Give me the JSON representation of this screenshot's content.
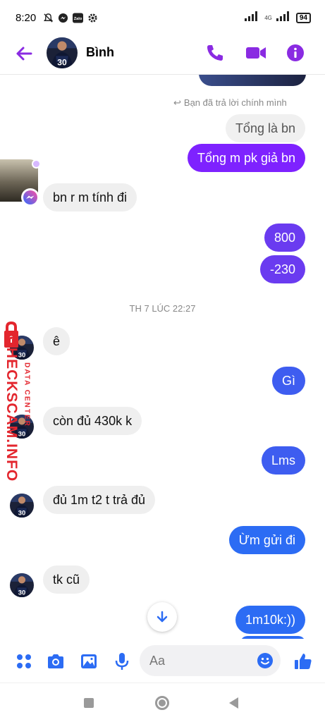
{
  "status_bar": {
    "time": "8:20",
    "icons": [
      "mute-bell-icon",
      "messenger-icon",
      "zalo-icon",
      "gear-icon"
    ],
    "network_label": "4G",
    "battery": "94"
  },
  "header": {
    "contact_name": "Bình",
    "accent_color": "#8a2be2"
  },
  "conversation": {
    "reply_note": "Bạn đã trả lời chính mình",
    "messages": [
      {
        "side": "out",
        "text": "Tổng là bn",
        "style": "reply-quote"
      },
      {
        "side": "out",
        "text": "Tổng m pk giả bn"
      },
      {
        "side": "in",
        "text": "bn r m tính đi"
      },
      {
        "side": "out",
        "text": "800"
      },
      {
        "side": "out",
        "text": "-230"
      },
      {
        "side": "in",
        "text": "ê"
      },
      {
        "side": "out",
        "text": "Gì"
      },
      {
        "side": "in",
        "text": "còn đủ 430k k"
      },
      {
        "side": "out",
        "text": "Lms"
      },
      {
        "side": "in",
        "text": "đủ 1m t2 t trả đủ"
      },
      {
        "side": "out",
        "text": "Ừm gửi đi"
      },
      {
        "side": "in",
        "text": "tk cũ"
      },
      {
        "side": "out",
        "text": "1m10k:))"
      }
    ],
    "timestamp": "TH 7 LÚC 22:27"
  },
  "composer": {
    "placeholder": "Aa"
  },
  "watermark": {
    "main": "CHECKSCAM.INFO",
    "sub": "DATA CENTER"
  },
  "colors": {
    "purple": "#7e22ff",
    "violet": "#6a3bf0",
    "blue": "#3e5df0",
    "bright_blue": "#2c6cf4",
    "incoming": "#efefef",
    "watermark_red": "#e3262e"
  }
}
